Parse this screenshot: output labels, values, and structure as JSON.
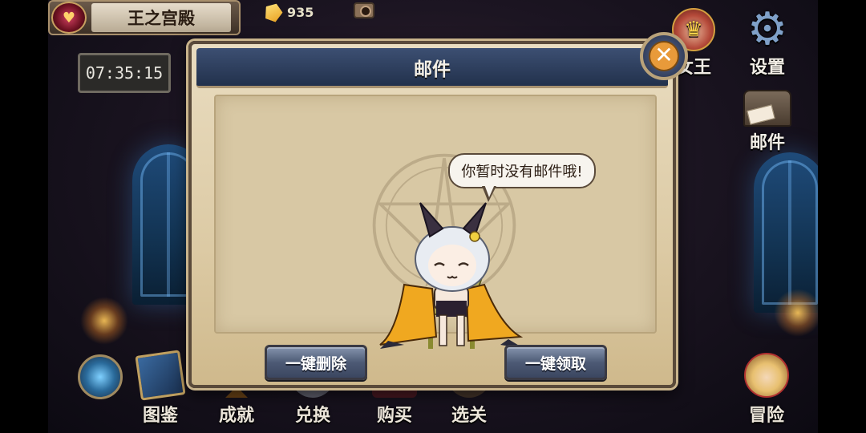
{
  "top_bar": {
    "location_label": "王之宫殿",
    "clock": "07:35:15",
    "gem_count": "935"
  },
  "right_menu": {
    "king_label": "女王",
    "settings_label": "设置",
    "mail_label": "邮件"
  },
  "bottom_menu": {
    "items": [
      {
        "label": "图鉴",
        "icon": "book-icon"
      },
      {
        "label": "成就",
        "icon": "trophy-icon"
      },
      {
        "label": "兑换",
        "icon": "exchange-icon"
      },
      {
        "label": "购买",
        "icon": "shop-icon"
      },
      {
        "label": "选关",
        "icon": "stage-icon"
      },
      {
        "label": "冒险",
        "icon": "adventure-icon"
      }
    ]
  },
  "mail_dialog": {
    "title": "邮件",
    "empty_message": "你暂时没有邮件哦!",
    "delete_all_label": "一键删除",
    "claim_all_label": "一键领取"
  },
  "colors": {
    "header_blue": "#2f3f5f",
    "parchment": "#e2d2b0",
    "button_blue": "#5d6b88",
    "close_orange": "#e89a3a"
  }
}
